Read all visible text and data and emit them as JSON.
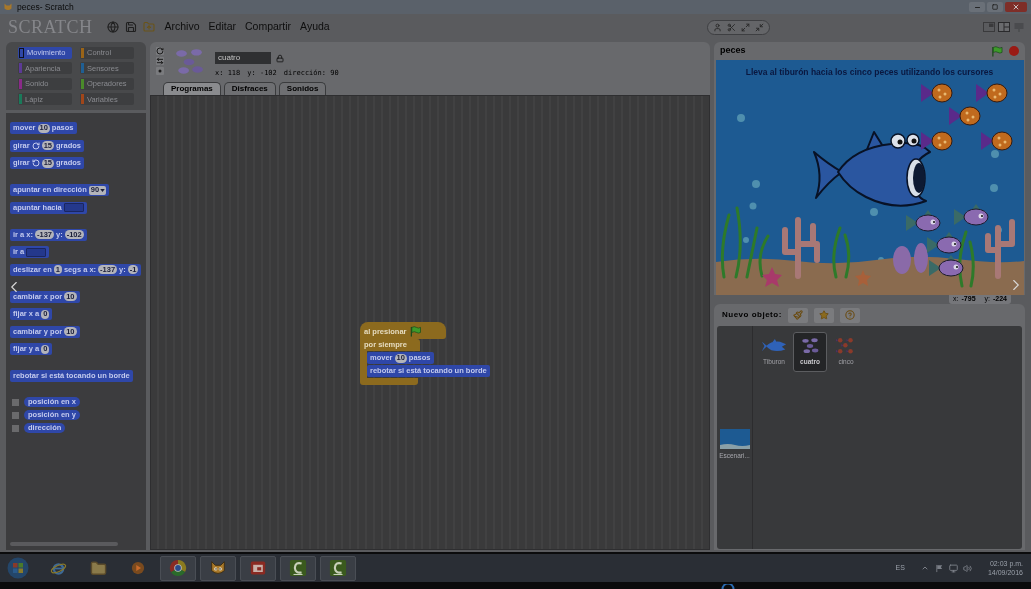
{
  "window": {
    "title": "peces- Scratch"
  },
  "logo": "SCRATCH",
  "menu": [
    "Archivo",
    "Editar",
    "Compartir",
    "Ayuda"
  ],
  "categories": [
    {
      "label": "Movimiento",
      "color": "#2f47a8",
      "selected": true
    },
    {
      "label": "Control",
      "color": "#9a6418",
      "selected": false
    },
    {
      "label": "Apariencia",
      "color": "#5c3a96",
      "selected": false
    },
    {
      "label": "Sensores",
      "color": "#1f5f94",
      "selected": false
    },
    {
      "label": "Sonido",
      "color": "#8a2a88",
      "selected": false
    },
    {
      "label": "Operadores",
      "color": "#4a8a2a",
      "selected": false
    },
    {
      "label": "Lápiz",
      "color": "#1a7a5a",
      "selected": false
    },
    {
      "label": "Variables",
      "color": "#a0461a",
      "selected": false
    }
  ],
  "palette": [
    [
      {
        "kind": "stack",
        "parts": [
          {
            "kind": "label",
            "text": "mover"
          },
          {
            "kind": "number",
            "value": "10"
          },
          {
            "kind": "label",
            "text": "pasos"
          }
        ]
      },
      {
        "kind": "stack",
        "parts": [
          {
            "kind": "label",
            "text": "girar"
          },
          {
            "kind": "turn_cw"
          },
          {
            "kind": "number",
            "value": "15"
          },
          {
            "kind": "label",
            "text": "grados"
          }
        ]
      },
      {
        "kind": "stack",
        "parts": [
          {
            "kind": "label",
            "text": "girar"
          },
          {
            "kind": "turn_ccw"
          },
          {
            "kind": "number",
            "value": "15"
          },
          {
            "kind": "label",
            "text": "grados"
          }
        ]
      }
    ],
    [
      {
        "kind": "stack",
        "parts": [
          {
            "kind": "label",
            "text": "apuntar en dirección"
          },
          {
            "kind": "dropdown",
            "value": "90"
          }
        ]
      },
      {
        "kind": "stack",
        "parts": [
          {
            "kind": "label",
            "text": "apuntar hacia"
          },
          {
            "kind": "slot"
          }
        ]
      }
    ],
    [
      {
        "kind": "stack",
        "parts": [
          {
            "kind": "label",
            "text": "ir a x:"
          },
          {
            "kind": "number",
            "value": "-137"
          },
          {
            "kind": "label",
            "text": "y:"
          },
          {
            "kind": "number",
            "value": "-102"
          }
        ]
      },
      {
        "kind": "stack",
        "parts": [
          {
            "kind": "label",
            "text": "ir a"
          },
          {
            "kind": "slot"
          }
        ]
      },
      {
        "kind": "stack",
        "parts": [
          {
            "kind": "label",
            "text": "deslizar en"
          },
          {
            "kind": "number",
            "value": "1"
          },
          {
            "kind": "label",
            "text": "segs a x:"
          },
          {
            "kind": "number",
            "value": "-137"
          },
          {
            "kind": "label",
            "text": "y:"
          },
          {
            "kind": "number",
            "value": "-1"
          }
        ]
      }
    ],
    [
      {
        "kind": "stack",
        "parts": [
          {
            "kind": "label",
            "text": "cambiar x por"
          },
          {
            "kind": "number",
            "value": "10"
          }
        ]
      },
      {
        "kind": "stack",
        "parts": [
          {
            "kind": "label",
            "text": "fijar x a"
          },
          {
            "kind": "number",
            "value": "0"
          }
        ]
      },
      {
        "kind": "stack",
        "parts": [
          {
            "kind": "label",
            "text": "cambiar y por"
          },
          {
            "kind": "number",
            "value": "10"
          }
        ]
      },
      {
        "kind": "stack",
        "parts": [
          {
            "kind": "label",
            "text": "fijar y a"
          },
          {
            "kind": "number",
            "value": "0"
          }
        ]
      }
    ],
    [
      {
        "kind": "stack",
        "parts": [
          {
            "kind": "label",
            "text": "rebotar si está tocando un borde"
          }
        ]
      }
    ],
    [
      {
        "kind": "reporter",
        "checked": false,
        "parts": [
          {
            "kind": "label",
            "text": "posición en x"
          }
        ]
      },
      {
        "kind": "reporter",
        "checked": false,
        "parts": [
          {
            "kind": "label",
            "text": "posición en y"
          }
        ]
      },
      {
        "kind": "reporter",
        "checked": false,
        "parts": [
          {
            "kind": "label",
            "text": "dirección"
          }
        ]
      }
    ]
  ],
  "sprite": {
    "name": "cuatro",
    "x": "x: 118",
    "y": "y: -102",
    "direction": "dirección: 90"
  },
  "tabs": [
    {
      "label": "Programas",
      "selected": true
    },
    {
      "label": "Disfraces",
      "selected": false
    },
    {
      "label": "Sonidos",
      "selected": false
    }
  ],
  "script": [
    {
      "kind": "hat",
      "parts": [
        {
          "kind": "label",
          "text": "al presionar"
        },
        {
          "kind": "flag"
        }
      ]
    },
    {
      "kind": "forever",
      "parts": [
        {
          "kind": "label",
          "text": "por siempre"
        }
      ],
      "children": [
        {
          "kind": "stack",
          "parts": [
            {
              "kind": "label",
              "text": "mover"
            },
            {
              "kind": "number",
              "value": "10"
            },
            {
              "kind": "label",
              "text": "pasos"
            }
          ]
        },
        {
          "kind": "stack",
          "parts": [
            {
              "kind": "label",
              "text": "rebotar si está tocando un borde"
            }
          ]
        }
      ]
    }
  ],
  "stage": {
    "title": "peces",
    "message": "Lleva al tiburón hacia los cinco peces utilizando los cursores"
  },
  "mouse_readout": [
    {
      "label": "x:",
      "value": "-795"
    },
    {
      "label": "y:",
      "value": "-224"
    }
  ],
  "sprites_panel": {
    "label": "Nuevo objeto:",
    "sprites": [
      {
        "name": "Tiburon",
        "kind": "shark",
        "selected": false
      },
      {
        "name": "cuatro",
        "kind": "fish_school",
        "selected": true
      },
      {
        "name": "cinco",
        "kind": "fish_pattern",
        "selected": false
      }
    ],
    "stage_thumb": {
      "name": "Escenari..."
    }
  },
  "taskbar": {
    "apps": [
      {
        "kind": "ie",
        "running": false
      },
      {
        "kind": "folder",
        "running": false
      },
      {
        "kind": "media",
        "running": false
      },
      {
        "kind": "chrome",
        "running": true
      },
      {
        "kind": "scratch",
        "running": true
      },
      {
        "kind": "red_app",
        "running": true
      },
      {
        "kind": "c_app",
        "running": true
      },
      {
        "kind": "c_app",
        "running": true
      }
    ],
    "language": "ES",
    "time": "02:03 p.m.",
    "date": "14/09/2016"
  }
}
